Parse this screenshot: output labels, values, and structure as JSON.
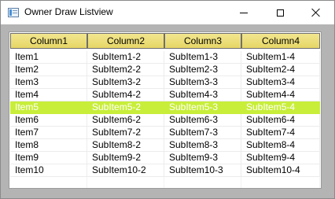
{
  "window": {
    "title": "Owner Draw Listview",
    "icon": "listview-app-icon"
  },
  "controls": {
    "minimize": "minimize-icon",
    "maximize": "maximize-icon",
    "close": "close-icon"
  },
  "colors": {
    "header_fill": "#e6d666",
    "selected_row": "#c8ee3a",
    "client_background": "#b4b4b4"
  },
  "listview": {
    "columns": [
      "Column1",
      "Column2",
      "Column3",
      "Column4"
    ],
    "selected_index": 4,
    "rows": [
      [
        "Item1",
        "SubItem1-2",
        "SubItem1-3",
        "SubItem1-4"
      ],
      [
        "Item2",
        "SubItem2-2",
        "SubItem2-3",
        "SubItem2-4"
      ],
      [
        "Item3",
        "SubItem3-2",
        "SubItem3-3",
        "SubItem3-4"
      ],
      [
        "Item4",
        "SubItem4-2",
        "SubItem4-3",
        "SubItem4-4"
      ],
      [
        "Item5",
        "SubItem5-2",
        "SubItem5-3",
        "SubItem5-4"
      ],
      [
        "Item6",
        "SubItem6-2",
        "SubItem6-3",
        "SubItem6-4"
      ],
      [
        "Item7",
        "SubItem7-2",
        "SubItem7-3",
        "SubItem7-4"
      ],
      [
        "Item8",
        "SubItem8-2",
        "SubItem8-3",
        "SubItem8-4"
      ],
      [
        "Item9",
        "SubItem9-2",
        "SubItem9-3",
        "SubItem9-4"
      ],
      [
        "Item10",
        "SubItem10-2",
        "SubItem10-3",
        "SubItem10-4"
      ]
    ]
  }
}
